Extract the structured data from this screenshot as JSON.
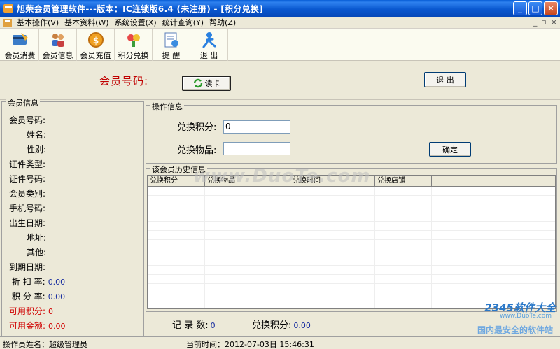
{
  "window": {
    "title": "旭荣会员管理软件---版本：IC连锁版6.4 (未注册) - [积分兑换]"
  },
  "menu": [
    "基本操作(V)",
    "基本资料(W)",
    "系统设置(X)",
    "统计查询(Y)",
    "帮助(Z)"
  ],
  "toolbar": [
    {
      "label": "会员消费",
      "icon": "card-icon"
    },
    {
      "label": "会员信息",
      "icon": "users-icon"
    },
    {
      "label": "会员充值",
      "icon": "coin-icon"
    },
    {
      "label": "积分兑换",
      "icon": "exchange-icon"
    },
    {
      "label": "提 醒",
      "icon": "reminder-icon"
    },
    {
      "label": "退 出",
      "icon": "exit-icon"
    }
  ],
  "top": {
    "member_no_label": "会员号码:",
    "read_card_label": "读卡",
    "exit_label": "退 出"
  },
  "member_info": {
    "title": "会员信息",
    "fields": [
      {
        "label": "会员号码:",
        "value": ""
      },
      {
        "label": "姓名:",
        "value": ""
      },
      {
        "label": "性别:",
        "value": ""
      },
      {
        "label": "证件类型:",
        "value": ""
      },
      {
        "label": "证件号码:",
        "value": ""
      },
      {
        "label": "会员类别:",
        "value": ""
      },
      {
        "label": "手机号码:",
        "value": ""
      },
      {
        "label": "出生日期:",
        "value": ""
      },
      {
        "label": "地址:",
        "value": ""
      },
      {
        "label": "其他:",
        "value": ""
      },
      {
        "label": "到期日期:",
        "value": ""
      },
      {
        "label": "折 扣 率:",
        "value": "0.00"
      },
      {
        "label": "积 分 率:",
        "value": "0.00"
      },
      {
        "label": "可用积分:",
        "value": "0"
      },
      {
        "label": "可用金额:",
        "value": "0.00"
      }
    ]
  },
  "operation": {
    "title": "操作信息",
    "points_label": "兑换积分:",
    "points_value": "0",
    "item_label": "兑换物品:",
    "item_value": "",
    "confirm_label": "确定"
  },
  "history": {
    "title": "该会员历史信息",
    "columns": [
      "兑换积分",
      "兑换物品",
      "兑换时间",
      "兑换店铺"
    ],
    "record_count_label": "记 录 数:",
    "record_count_value": "0",
    "total_points_label": "兑换积分:",
    "total_points_value": "0.00"
  },
  "status": {
    "operator": "操作员姓名：超级管理员",
    "time": "当前时间：2012-07-03日  15:46:31"
  },
  "watermark": {
    "center": "www.DuoTe.com",
    "brand": "2345软件大全",
    "url": "www.DuoTe.com",
    "slogan": "国内最安全的软件站"
  }
}
